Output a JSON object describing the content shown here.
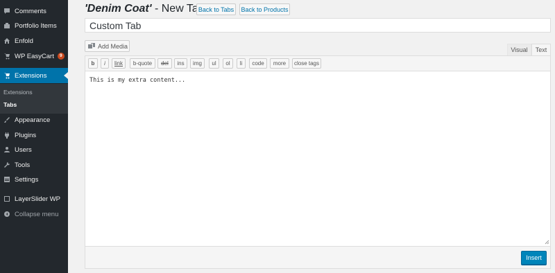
{
  "sidebar": {
    "items": [
      {
        "label": "Comments",
        "icon": "comment-icon"
      },
      {
        "label": "Portfolio Items",
        "icon": "portfolio-icon"
      },
      {
        "label": "Enfold",
        "icon": "home-icon"
      },
      {
        "label": "WP EasyCart",
        "icon": "cart-icon",
        "badge": "9"
      },
      {
        "label": "Extensions",
        "icon": "cart-icon"
      },
      {
        "label": "Appearance",
        "icon": "brush-icon"
      },
      {
        "label": "Plugins",
        "icon": "plugin-icon"
      },
      {
        "label": "Users",
        "icon": "users-icon"
      },
      {
        "label": "Tools",
        "icon": "wrench-icon"
      },
      {
        "label": "Settings",
        "icon": "settings-icon"
      },
      {
        "label": "LayerSlider WP",
        "icon": "layers-icon"
      },
      {
        "label": "Collapse menu",
        "icon": "collapse-icon"
      }
    ],
    "submenu": [
      {
        "label": "Extensions"
      },
      {
        "label": "Tabs"
      }
    ]
  },
  "header": {
    "product_name": "'Denim Coat'",
    "title_suffix": " - New Tab",
    "back_to_tabs": "Back to Tabs",
    "back_to_products": "Back to Products"
  },
  "form": {
    "tab_title_value": "Custom Tab",
    "add_media_label": "Add Media",
    "visual_tab": "Visual",
    "text_tab": "Text",
    "quicktags": [
      "b",
      "i",
      "link",
      "b-quote",
      "del",
      "ins",
      "img",
      "ul",
      "ol",
      "li",
      "code",
      "more",
      "close tags"
    ],
    "content": "This is my extra content...",
    "insert_label": "Insert"
  },
  "colors": {
    "sidebar_bg": "#23282d",
    "active_bg": "#0073aa",
    "primary_button": "#0085ba",
    "badge": "#ca4a1f"
  }
}
